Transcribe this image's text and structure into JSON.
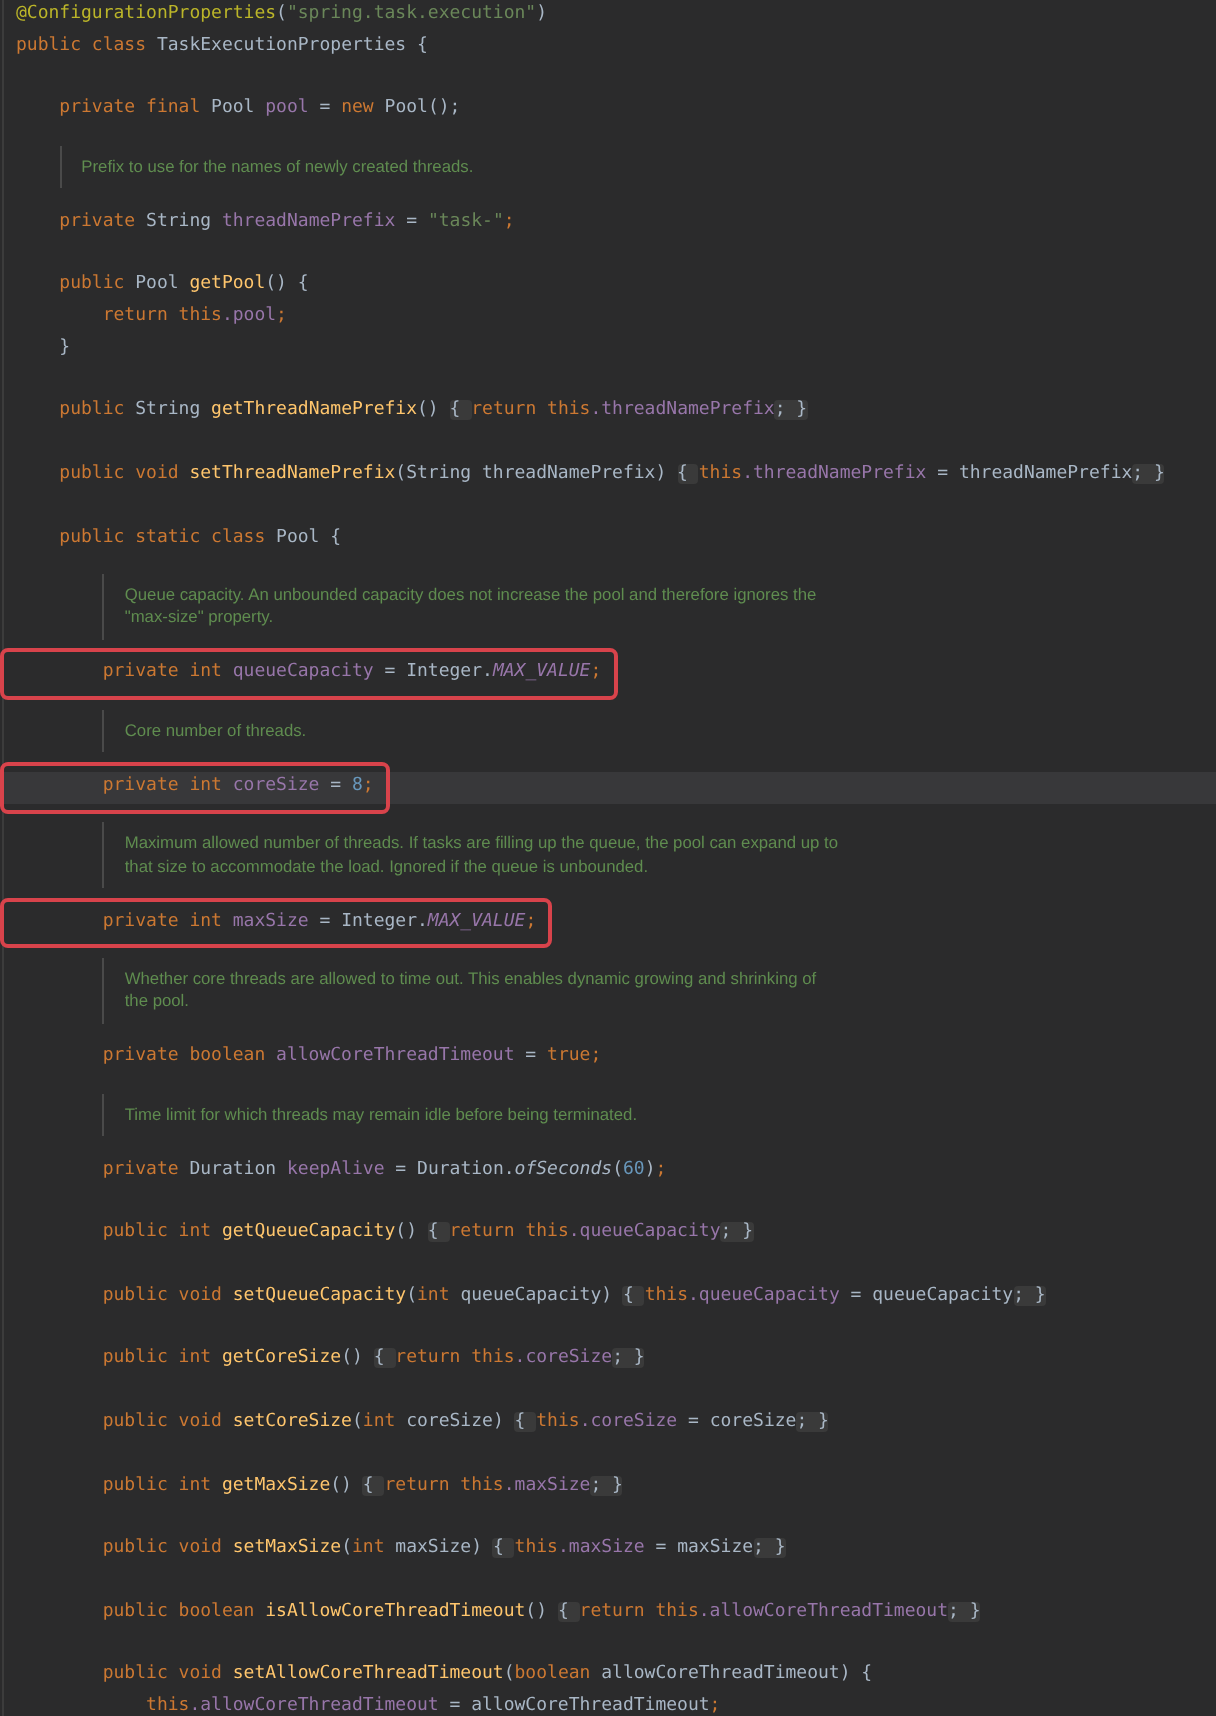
{
  "editor": {
    "lines": [
      {
        "kind": "code",
        "highlighted": false,
        "current": false,
        "tokens": [
          {
            "color": "#bbb529",
            "text": "@ConfigurationProperties"
          },
          {
            "color": "#a9b7c6",
            "text": "("
          },
          {
            "color": "#6a8759",
            "text": "\"spring.task.execution\""
          },
          {
            "color": "#a9b7c6",
            "text": ")"
          }
        ]
      },
      {
        "kind": "code",
        "highlighted": false,
        "current": false,
        "tokens": [
          {
            "color": "#cc7832",
            "text": "public class "
          },
          {
            "color": "#a9b7c6",
            "text": "TaskExecutionProperties {"
          }
        ]
      },
      {
        "kind": "blank"
      },
      {
        "kind": "code",
        "highlighted": false,
        "current": false,
        "tokens": [
          {
            "color": "#cc7832",
            "text": "    private final "
          },
          {
            "color": "#a9b7c6",
            "text": "Pool "
          },
          {
            "color": "#9876aa",
            "text": "pool"
          },
          {
            "color": "#a9b7c6",
            "text": " = "
          },
          {
            "color": "#cc7832",
            "text": "new "
          },
          {
            "color": "#a9b7c6",
            "text": "Pool();"
          }
        ]
      },
      {
        "kind": "doc",
        "lines": [
          "Prefix to use for the names of newly created threads."
        ]
      },
      {
        "kind": "code",
        "highlighted": false,
        "current": false,
        "tokens": [
          {
            "color": "#cc7832",
            "text": "    private "
          },
          {
            "color": "#a9b7c6",
            "text": "String "
          },
          {
            "color": "#9876aa",
            "text": "threadNamePrefix"
          },
          {
            "color": "#a9b7c6",
            "text": " = "
          },
          {
            "color": "#6a8759",
            "text": "\"task-\""
          },
          {
            "color": "#cc7832",
            "text": ";"
          }
        ]
      },
      {
        "kind": "blank"
      },
      {
        "kind": "code",
        "highlighted": false,
        "current": false,
        "tokens": [
          {
            "color": "#cc7832",
            "text": "    public "
          },
          {
            "color": "#a9b7c6",
            "text": "Pool "
          },
          {
            "color": "#ffc66d",
            "text": "getPool"
          },
          {
            "color": "#a9b7c6",
            "text": "() {"
          }
        ]
      },
      {
        "kind": "code",
        "highlighted": false,
        "current": false,
        "tokens": [
          {
            "color": "#cc7832",
            "text": "        return this"
          },
          {
            "color": "#9876aa",
            "text": ".pool"
          },
          {
            "color": "#cc7832",
            "text": ";"
          }
        ]
      },
      {
        "kind": "code",
        "highlighted": false,
        "current": false,
        "tokens": [
          {
            "color": "#a9b7c6",
            "text": "    }"
          }
        ]
      },
      {
        "kind": "blank"
      },
      {
        "kind": "code",
        "highlighted": false,
        "current": false,
        "tokens": [
          {
            "color": "#cc7832",
            "text": "    public ",
            "folded": false
          },
          {
            "color": "#a9b7c6",
            "text": "String ",
            "folded": false
          },
          {
            "color": "#ffc66d",
            "text": "getThreadNamePrefix",
            "folded": false
          },
          {
            "color": "#a9b7c6",
            "text": "() ",
            "folded": false
          },
          {
            "color": "#a9b7c6",
            "text": "{ ",
            "folded": true
          },
          {
            "color": "#cc7832",
            "text": "return this",
            "folded": false
          },
          {
            "color": "#9876aa",
            "text": ".threadNamePrefix",
            "folded": false
          },
          {
            "color": "#a9b7c6",
            "text": "; }",
            "folded": true
          }
        ]
      },
      {
        "kind": "blank"
      },
      {
        "kind": "code",
        "highlighted": false,
        "current": false,
        "tokens": [
          {
            "color": "#cc7832",
            "text": "    public void ",
            "folded": false
          },
          {
            "color": "#ffc66d",
            "text": "setThreadNamePrefix",
            "folded": false
          },
          {
            "color": "#a9b7c6",
            "text": "(String threadNamePrefix) ",
            "folded": false
          },
          {
            "color": "#a9b7c6",
            "text": "{ ",
            "folded": true
          },
          {
            "color": "#cc7832",
            "text": "this",
            "folded": false
          },
          {
            "color": "#9876aa",
            "text": ".threadNamePrefix",
            "folded": false
          },
          {
            "color": "#a9b7c6",
            "text": " = threadNamePrefix",
            "folded": false
          },
          {
            "color": "#a9b7c6",
            "text": "; }",
            "folded": true
          }
        ]
      },
      {
        "kind": "blank"
      },
      {
        "kind": "code",
        "highlighted": false,
        "current": false,
        "tokens": [
          {
            "color": "#cc7832",
            "text": "    public static class "
          },
          {
            "color": "#a9b7c6",
            "text": "Pool {"
          }
        ]
      },
      {
        "kind": "doc",
        "lines": [
          "Queue capacity. An unbounded capacity does not increase the pool and therefore ignores the",
          "\"max-size\" property."
        ]
      },
      {
        "kind": "code",
        "highlighted": true,
        "current": false,
        "tokens": [
          {
            "color": "#cc7832",
            "text": "        private int "
          },
          {
            "color": "#9876aa",
            "text": "queueCapacity"
          },
          {
            "color": "#a9b7c6",
            "text": " = Integer."
          },
          {
            "color": "#9876aa",
            "text": "*MAX_VALUE*"
          },
          {
            "color": "#cc7832",
            "text": ";"
          }
        ]
      },
      {
        "kind": "doc",
        "lines": [
          "Core number of threads."
        ]
      },
      {
        "kind": "code",
        "highlighted": true,
        "current": true,
        "tokens": [
          {
            "color": "#cc7832",
            "text": "        private int "
          },
          {
            "color": "#9876aa",
            "text": "coreSize"
          },
          {
            "color": "#a9b7c6",
            "text": " = "
          },
          {
            "color": "#6897bb",
            "text": "8"
          },
          {
            "color": "#cc7832",
            "text": ";"
          }
        ]
      },
      {
        "kind": "doc",
        "lines": [
          "Maximum allowed number of threads. If tasks are filling up the queue, the pool can expand up to",
          "that size to accommodate the load. Ignored if the queue is unbounded."
        ]
      },
      {
        "kind": "code",
        "highlighted": true,
        "current": false,
        "tokens": [
          {
            "color": "#cc7832",
            "text": "        private int "
          },
          {
            "color": "#9876aa",
            "text": "maxSize"
          },
          {
            "color": "#a9b7c6",
            "text": " = Integer."
          },
          {
            "color": "#9876aa",
            "text": "*MAX_VALUE*"
          },
          {
            "color": "#cc7832",
            "text": ";"
          }
        ]
      },
      {
        "kind": "doc",
        "lines": [
          "Whether core threads are allowed to time out. This enables dynamic growing and shrinking of",
          "the pool."
        ]
      },
      {
        "kind": "code",
        "highlighted": false,
        "current": false,
        "tokens": [
          {
            "color": "#cc7832",
            "text": "        private boolean "
          },
          {
            "color": "#9876aa",
            "text": "allowCoreThreadTimeout"
          },
          {
            "color": "#a9b7c6",
            "text": " = "
          },
          {
            "color": "#cc7832",
            "text": "true;"
          }
        ]
      },
      {
        "kind": "doc",
        "lines": [
          "Time limit for which threads may remain idle before being terminated."
        ]
      },
      {
        "kind": "code",
        "highlighted": false,
        "current": false,
        "tokens": [
          {
            "color": "#cc7832",
            "text": "        private "
          },
          {
            "color": "#a9b7c6",
            "text": "Duration "
          },
          {
            "color": "#9876aa",
            "text": "keepAlive"
          },
          {
            "color": "#a9b7c6",
            "text": " = Duration.*ofSeconds*("
          },
          {
            "color": "#6897bb",
            "text": "60"
          },
          {
            "color": "#a9b7c6",
            "text": ")"
          },
          {
            "color": "#cc7832",
            "text": ";"
          }
        ]
      },
      {
        "kind": "blank"
      },
      {
        "kind": "code",
        "highlighted": false,
        "current": false,
        "tokens": [
          {
            "color": "#cc7832",
            "text": "        public int ",
            "folded": false
          },
          {
            "color": "#ffc66d",
            "text": "getQueueCapacity",
            "folded": false
          },
          {
            "color": "#a9b7c6",
            "text": "() ",
            "folded": false
          },
          {
            "color": "#a9b7c6",
            "text": "{ ",
            "folded": true
          },
          {
            "color": "#cc7832",
            "text": "return this",
            "folded": false
          },
          {
            "color": "#9876aa",
            "text": ".queueCapacity",
            "folded": false
          },
          {
            "color": "#a9b7c6",
            "text": "; }",
            "folded": true
          }
        ]
      },
      {
        "kind": "blank"
      },
      {
        "kind": "code",
        "highlighted": false,
        "current": false,
        "tokens": [
          {
            "color": "#cc7832",
            "text": "        public void ",
            "folded": false
          },
          {
            "color": "#ffc66d",
            "text": "setQueueCapacity",
            "folded": false
          },
          {
            "color": "#a9b7c6",
            "text": "(",
            "folded": false
          },
          {
            "color": "#cc7832",
            "text": "int ",
            "folded": false
          },
          {
            "color": "#a9b7c6",
            "text": "queueCapacity) ",
            "folded": false
          },
          {
            "color": "#a9b7c6",
            "text": "{ ",
            "folded": true
          },
          {
            "color": "#cc7832",
            "text": "this",
            "folded": false
          },
          {
            "color": "#9876aa",
            "text": ".queueCapacity",
            "folded": false
          },
          {
            "color": "#a9b7c6",
            "text": " = queueCapacity",
            "folded": false
          },
          {
            "color": "#a9b7c6",
            "text": "; }",
            "folded": true
          }
        ]
      },
      {
        "kind": "blank"
      },
      {
        "kind": "code",
        "highlighted": false,
        "current": false,
        "tokens": [
          {
            "color": "#cc7832",
            "text": "        public int ",
            "folded": false
          },
          {
            "color": "#ffc66d",
            "text": "getCoreSize",
            "folded": false
          },
          {
            "color": "#a9b7c6",
            "text": "() ",
            "folded": false
          },
          {
            "color": "#a9b7c6",
            "text": "{ ",
            "folded": true
          },
          {
            "color": "#cc7832",
            "text": "return this",
            "folded": false
          },
          {
            "color": "#9876aa",
            "text": ".coreSize",
            "folded": false
          },
          {
            "color": "#a9b7c6",
            "text": "; }",
            "folded": true
          }
        ]
      },
      {
        "kind": "blank"
      },
      {
        "kind": "code",
        "highlighted": false,
        "current": false,
        "tokens": [
          {
            "color": "#cc7832",
            "text": "        public void ",
            "folded": false
          },
          {
            "color": "#ffc66d",
            "text": "setCoreSize",
            "folded": false
          },
          {
            "color": "#a9b7c6",
            "text": "(",
            "folded": false
          },
          {
            "color": "#cc7832",
            "text": "int ",
            "folded": false
          },
          {
            "color": "#a9b7c6",
            "text": "coreSize) ",
            "folded": false
          },
          {
            "color": "#a9b7c6",
            "text": "{ ",
            "folded": true
          },
          {
            "color": "#cc7832",
            "text": "this",
            "folded": false
          },
          {
            "color": "#9876aa",
            "text": ".coreSize",
            "folded": false
          },
          {
            "color": "#a9b7c6",
            "text": " = coreSize",
            "folded": false
          },
          {
            "color": "#a9b7c6",
            "text": "; }",
            "folded": true
          }
        ]
      },
      {
        "kind": "blank"
      },
      {
        "kind": "code",
        "highlighted": false,
        "current": false,
        "tokens": [
          {
            "color": "#cc7832",
            "text": "        public int ",
            "folded": false
          },
          {
            "color": "#ffc66d",
            "text": "getMaxSize",
            "folded": false
          },
          {
            "color": "#a9b7c6",
            "text": "() ",
            "folded": false
          },
          {
            "color": "#a9b7c6",
            "text": "{ ",
            "folded": true
          },
          {
            "color": "#cc7832",
            "text": "return this",
            "folded": false
          },
          {
            "color": "#9876aa",
            "text": ".maxSize",
            "folded": false
          },
          {
            "color": "#a9b7c6",
            "text": "; }",
            "folded": true
          }
        ]
      },
      {
        "kind": "blank"
      },
      {
        "kind": "code",
        "highlighted": false,
        "current": false,
        "tokens": [
          {
            "color": "#cc7832",
            "text": "        public void ",
            "folded": false
          },
          {
            "color": "#ffc66d",
            "text": "setMaxSize",
            "folded": false
          },
          {
            "color": "#a9b7c6",
            "text": "(",
            "folded": false
          },
          {
            "color": "#cc7832",
            "text": "int ",
            "folded": false
          },
          {
            "color": "#a9b7c6",
            "text": "maxSize) ",
            "folded": false
          },
          {
            "color": "#a9b7c6",
            "text": "{ ",
            "folded": true
          },
          {
            "color": "#cc7832",
            "text": "this",
            "folded": false
          },
          {
            "color": "#9876aa",
            "text": ".maxSize",
            "folded": false
          },
          {
            "color": "#a9b7c6",
            "text": " = maxSize",
            "folded": false
          },
          {
            "color": "#a9b7c6",
            "text": "; }",
            "folded": true
          }
        ]
      },
      {
        "kind": "blank"
      },
      {
        "kind": "code",
        "highlighted": false,
        "current": false,
        "tokens": [
          {
            "color": "#cc7832",
            "text": "        public boolean ",
            "folded": false
          },
          {
            "color": "#ffc66d",
            "text": "isAllowCoreThreadTimeout",
            "folded": false
          },
          {
            "color": "#a9b7c6",
            "text": "() ",
            "folded": false
          },
          {
            "color": "#a9b7c6",
            "text": "{ ",
            "folded": true
          },
          {
            "color": "#cc7832",
            "text": "return this",
            "folded": false
          },
          {
            "color": "#9876aa",
            "text": ".allowCoreThreadTimeout",
            "folded": false
          },
          {
            "color": "#a9b7c6",
            "text": "; }",
            "folded": true
          }
        ]
      },
      {
        "kind": "blank"
      },
      {
        "kind": "code",
        "highlighted": false,
        "current": false,
        "tokens": [
          {
            "color": "#cc7832",
            "text": "        public void "
          },
          {
            "color": "#ffc66d",
            "text": "setAllowCoreThreadTimeout"
          },
          {
            "color": "#a9b7c6",
            "text": "("
          },
          {
            "color": "#cc7832",
            "text": "boolean "
          },
          {
            "color": "#a9b7c6",
            "text": "allowCoreThreadTimeout) {"
          }
        ]
      },
      {
        "kind": "code",
        "highlighted": false,
        "current": false,
        "tokens": [
          {
            "color": "#cc7832",
            "text": "            this"
          },
          {
            "color": "#9876aa",
            "text": ".allowCoreThreadTimeout"
          },
          {
            "color": "#a9b7c6",
            "text": " = allowCoreThreadTimeout"
          },
          {
            "color": "#cc7832",
            "text": ";"
          }
        ]
      }
    ]
  }
}
